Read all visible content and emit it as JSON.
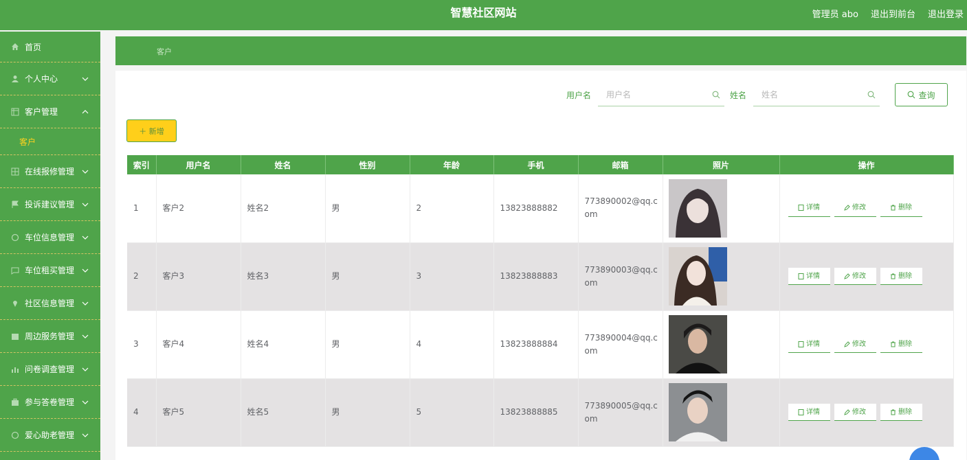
{
  "header": {
    "title": "智慧社区网站",
    "user": "管理员 abo",
    "to_front": "退出到前台",
    "logout": "退出登录"
  },
  "sidebar": {
    "items": [
      {
        "label": "首页",
        "icon": "home-icon"
      },
      {
        "label": "个人中心",
        "icon": "user-icon"
      },
      {
        "label": "客户管理",
        "icon": "grid-icon"
      },
      {
        "label": "在线报修管理",
        "icon": "grid-icon"
      },
      {
        "label": "投诉建议管理",
        "icon": "flag-icon"
      },
      {
        "label": "车位信息管理",
        "icon": "circle-icon"
      },
      {
        "label": "车位租买管理",
        "icon": "tag-icon"
      },
      {
        "label": "社区信息管理",
        "icon": "pin-icon"
      },
      {
        "label": "周边服务管理",
        "icon": "calendar-icon"
      },
      {
        "label": "问卷调查管理",
        "icon": "chart-icon"
      },
      {
        "label": "参与答卷管理",
        "icon": "briefcase-icon"
      },
      {
        "label": "爱心助老管理",
        "icon": "circle-icon"
      }
    ],
    "sub_item": "客户"
  },
  "breadcrumb": "客户",
  "search": {
    "username_label": "用户名",
    "username_placeholder": "用户名",
    "name_label": "姓名",
    "name_placeholder": "姓名",
    "query_button": "查询"
  },
  "add_button": "＋ 新增",
  "table": {
    "headers": [
      "索引",
      "用户名",
      "姓名",
      "性别",
      "年龄",
      "手机",
      "邮箱",
      "照片",
      "操作"
    ],
    "rows": [
      {
        "index": "1",
        "username": "客户2",
        "name": "姓名2",
        "gender": "男",
        "age": "2",
        "phone": "13823888882",
        "email": "773890002@qq.c​om"
      },
      {
        "index": "2",
        "username": "客户3",
        "name": "姓名3",
        "gender": "男",
        "age": "3",
        "phone": "13823888883",
        "email": "773890003@qq.c​om"
      },
      {
        "index": "3",
        "username": "客户4",
        "name": "姓名4",
        "gender": "男",
        "age": "4",
        "phone": "13823888884",
        "email": "773890004@qq.c​om"
      },
      {
        "index": "4",
        "username": "客户5",
        "name": "姓名5",
        "gender": "男",
        "age": "5",
        "phone": "13823888885",
        "email": "773890005@qq.c​om"
      }
    ],
    "ops": {
      "detail": "详情",
      "edit": "修改",
      "delete": "删除"
    }
  },
  "colors": {
    "primary": "#4fa44a",
    "accent": "#ffcf1a",
    "row_alt": "#e4e2e3"
  }
}
